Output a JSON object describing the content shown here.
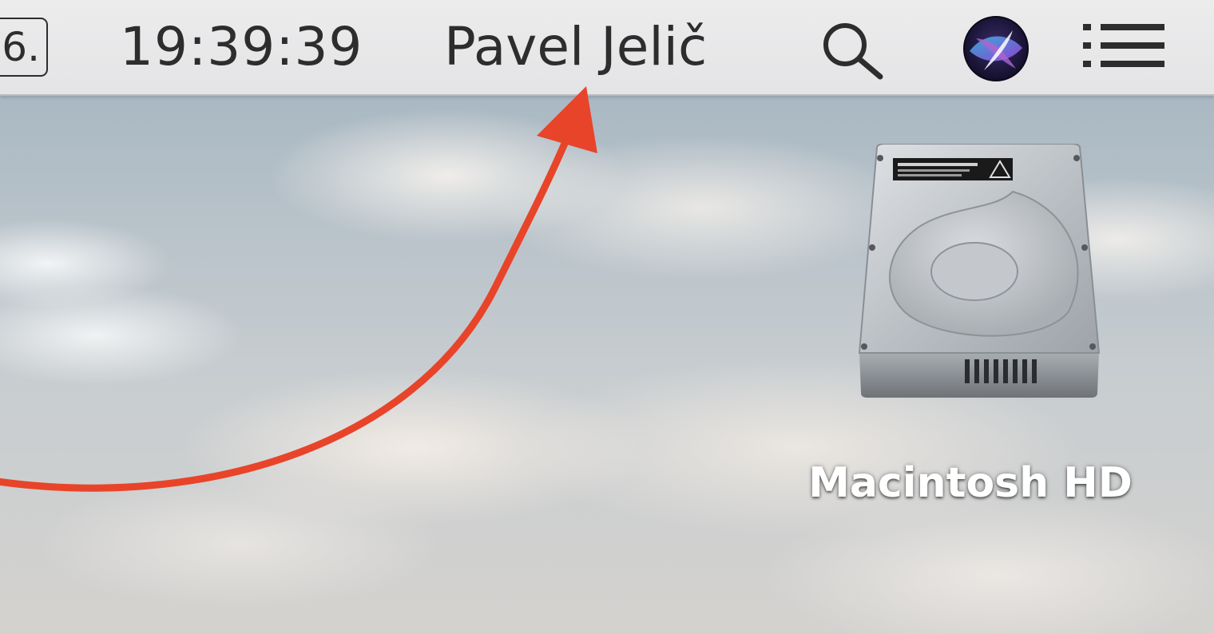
{
  "menubar": {
    "date_fragment": "6.",
    "clock": "19:39:39",
    "user_name": "Pavel Jelič",
    "icons": {
      "search": "spotlight-search-icon",
      "siri": "siri-icon",
      "notifications": "notification-center-icon"
    }
  },
  "desktop": {
    "items": [
      {
        "label": "Macintosh HD",
        "icon": "hard-drive-icon"
      }
    ]
  },
  "annotation": {
    "arrow_color": "#e8442a",
    "points_to": "user_name"
  },
  "colors": {
    "menubar_bg": "#e6e6e8",
    "menubar_text": "#2d2d2d",
    "arrow": "#e8442a"
  }
}
